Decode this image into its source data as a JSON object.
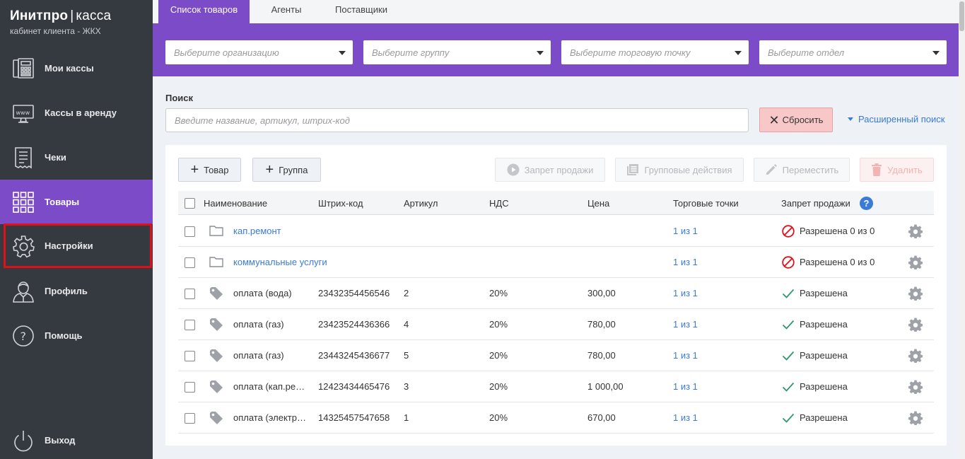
{
  "app": {
    "title_bold": "Инитпро",
    "title_sep": "|",
    "title_light": "касса",
    "subtitle": "кабинет клиента - ЖКХ"
  },
  "sidebar": {
    "items": [
      {
        "label": "Мои кассы",
        "icon": "cash-register-icon"
      },
      {
        "label": "Кассы в аренду",
        "icon": "www-monitor-icon"
      },
      {
        "label": "Чеки",
        "icon": "receipt-icon"
      },
      {
        "label": "Товары",
        "icon": "grid-icon",
        "active": true
      },
      {
        "label": "Настройки",
        "icon": "gear-icon",
        "highlighted": true
      },
      {
        "label": "Профиль",
        "icon": "user-icon"
      },
      {
        "label": "Помощь",
        "icon": "help-icon"
      }
    ],
    "logout_label": "Выход"
  },
  "tabs": [
    {
      "label": "Список товаров",
      "active": true
    },
    {
      "label": "Агенты"
    },
    {
      "label": "Поставщики"
    }
  ],
  "filters": {
    "organization_placeholder": "Выберите организацию",
    "group_placeholder": "Выберите группу",
    "point_placeholder": "Выберите торговую точку",
    "department_placeholder": "Выберите отдел"
  },
  "search": {
    "label": "Поиск",
    "placeholder": "Введите название, артикул, штрих-код",
    "reset_label": "Сбросить",
    "advanced_label": "Расширенный поиск"
  },
  "toolbar": {
    "add_item_label": "Товар",
    "add_group_label": "Группа",
    "ban_sale_label": "Запрет продажи",
    "group_actions_label": "Групповые действия",
    "move_label": "Переместить",
    "delete_label": "Удалить"
  },
  "table": {
    "columns": {
      "name": "Наименование",
      "barcode": "Штрих-код",
      "article": "Артикул",
      "vat": "НДС",
      "price": "Цена",
      "points": "Торговые точки",
      "ban": "Запрет продажи"
    },
    "help_glyph": "?",
    "rows": [
      {
        "type": "folder",
        "name": "кап.ремонт",
        "barcode": "",
        "article": "",
        "vat": "",
        "price": "",
        "points": "1 из 1",
        "status": "Разрешена 0 из 0",
        "status_kind": "ban"
      },
      {
        "type": "folder",
        "name": "коммунальные услуги",
        "barcode": "",
        "article": "",
        "vat": "",
        "price": "",
        "points": "1 из 1",
        "status": "Разрешена 0 из 0",
        "status_kind": "ban"
      },
      {
        "type": "item",
        "name": "оплата (вода)",
        "barcode": "23432354456546",
        "article": "2",
        "vat": "20%",
        "price": "300,00",
        "points": "1 из 1",
        "status": "Разрешена",
        "status_kind": "ok"
      },
      {
        "type": "item",
        "name": "оплата (газ)",
        "barcode": "23423524436366",
        "article": "4",
        "vat": "20%",
        "price": "780,00",
        "points": "1 из 1",
        "status": "Разрешена",
        "status_kind": "ok"
      },
      {
        "type": "item",
        "name": "оплата (газ)",
        "barcode": "23443245436677",
        "article": "5",
        "vat": "20%",
        "price": "780,00",
        "points": "1 из 1",
        "status": "Разрешена",
        "status_kind": "ok"
      },
      {
        "type": "item",
        "name": "оплата (кап.ре…",
        "barcode": "12423434465476",
        "article": "3",
        "vat": "20%",
        "price": "1 000,00",
        "points": "1 из 1",
        "status": "Разрешена",
        "status_kind": "ok"
      },
      {
        "type": "item",
        "name": "оплата (электр…",
        "barcode": "14325457547658",
        "article": "1",
        "vat": "20%",
        "price": "670,00",
        "points": "1 из 1",
        "status": "Разрешена",
        "status_kind": "ok"
      }
    ]
  },
  "colors": {
    "accent": "#7b4bc8",
    "sidebar": "#353a41",
    "link": "#3a7bd5",
    "danger": "#e0101a",
    "ok": "#2a9a6a"
  }
}
